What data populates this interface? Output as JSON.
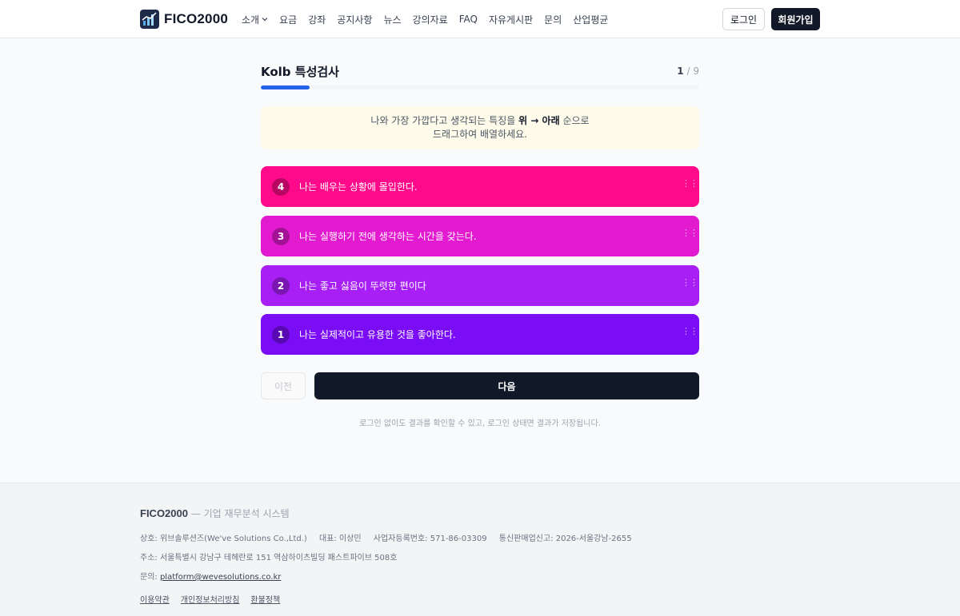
{
  "header": {
    "logo_text": "FICO2000",
    "nav": [
      {
        "label": "소개",
        "has_dropdown": true
      },
      {
        "label": "요금"
      },
      {
        "label": "강좌"
      },
      {
        "label": "공지사항"
      },
      {
        "label": "뉴스"
      },
      {
        "label": "강의자료"
      },
      {
        "label": "FAQ"
      },
      {
        "label": "자유게시판"
      },
      {
        "label": "문의"
      },
      {
        "label": "산업평균"
      }
    ],
    "login_label": "로그인",
    "signup_label": "회원가입"
  },
  "test": {
    "title": "Kolb 특성검사",
    "current_step": "1",
    "separator": "/",
    "total_steps": "9",
    "progress_fraction": 0.111,
    "progress_color": "#2563eb",
    "instruction_line1_pre": "나와 가장 가깝다고 생각되는 특징을 ",
    "instruction_line1_bold": "위 → 아래",
    "instruction_line1_post": " 순으로",
    "instruction_line2": "드래그하여 배열하세요.",
    "cards": [
      {
        "rank": "4",
        "text": "나는 배우는 상황에 몰입한다.",
        "color": "#ff0a8a"
      },
      {
        "rank": "3",
        "text": "나는 실행하기 전에 생각하는 시간을 갖는다.",
        "color": "#e21ad0"
      },
      {
        "rank": "2",
        "text": "나는 좋고 싫음이 뚜렷한 편이다",
        "color": "#a81ff5"
      },
      {
        "rank": "1",
        "text": "나는 실제적이고 유용한 것을 좋아한다.",
        "color": "#7a0df5"
      }
    ],
    "prev_label": "이전",
    "next_label": "다음",
    "note": "로그인 없이도 결과를 확인할 수 있고, 로그인 상태면 결과가 저장됩니다."
  },
  "footer": {
    "brand": "FICO2000",
    "tagline": " — 기업 재무분석 시스템",
    "company": "상호: 위브솔루션즈(We've Solutions Co.,Ltd.)",
    "ceo": "대표: 이상민",
    "biz_no": "사업자등록번호: 571-86-03309",
    "ecommerce_no": "통신판매업신고: 2026-서울강남-2655",
    "address": "주소: 서울특별시 강남구 테헤란로 151 역삼하이츠빌딩 패스트파이브 508호",
    "contact_prefix": "문의: ",
    "contact_email": "platform@wevesolutions.co.kr",
    "links": [
      "이용약관",
      "개인정보처리방침",
      "환불정책"
    ]
  }
}
